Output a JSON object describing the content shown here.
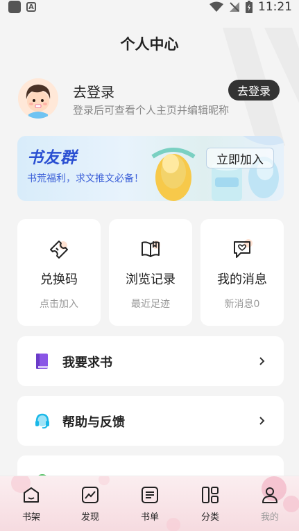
{
  "status_bar": {
    "time": "11:21"
  },
  "page": {
    "title": "个人中心"
  },
  "profile": {
    "name": "去登录",
    "subtitle": "登录后可查看个人主页并编辑昵称",
    "login_button": "去登录"
  },
  "banner": {
    "title": "书友群",
    "subtitle": "书荒福利，求文推文必备！",
    "button": "立即加入"
  },
  "cards": [
    {
      "icon": "ticket-icon",
      "title": "兑换码",
      "subtitle": "点击加入"
    },
    {
      "icon": "book-open-icon",
      "title": "浏览记录",
      "subtitle": "最近足迹"
    },
    {
      "icon": "message-heart-icon",
      "title": "我的消息",
      "subtitle": "新消息0"
    }
  ],
  "menu": [
    {
      "icon": "book-icon",
      "label": "我要求书"
    },
    {
      "icon": "headset-icon",
      "label": "帮助与反馈"
    }
  ],
  "tabs": [
    {
      "icon": "bookshelf-icon",
      "label": "书架"
    },
    {
      "icon": "trend-icon",
      "label": "发现"
    },
    {
      "icon": "list-icon",
      "label": "书单"
    },
    {
      "icon": "category-icon",
      "label": "分类"
    },
    {
      "icon": "user-icon",
      "label": "我的"
    }
  ],
  "colors": {
    "accent_blue": "#2a4fd2",
    "dark_button": "#333333",
    "book_purple": "#8a55e6",
    "headset_cyan": "#1ab8e8"
  }
}
